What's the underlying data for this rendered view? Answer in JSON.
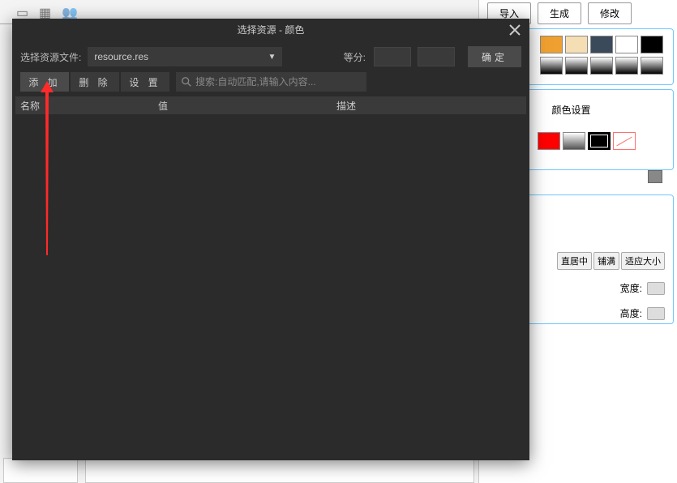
{
  "background": {
    "top_buttons": {
      "import": "导入",
      "generate": "生成",
      "modify": "修改"
    },
    "color_settings_label": "颜色设置",
    "size_buttons": {
      "center": "直居中",
      "fill": "铺满",
      "fit": "适应大小"
    },
    "width_label": "宽度:",
    "height_label": "高度:"
  },
  "modal": {
    "title": "选择资源 - 颜色",
    "file_label": "选择资源文件:",
    "file_value": "resource.res",
    "score_label": "等分:",
    "confirm": "确定",
    "tabs": {
      "add": "添 加",
      "delete": "删 除",
      "settings": "设 置"
    },
    "search_placeholder": "搜索:自动匹配,请输入内容...",
    "columns": {
      "name": "名称",
      "value": "值",
      "desc": "描述"
    }
  }
}
